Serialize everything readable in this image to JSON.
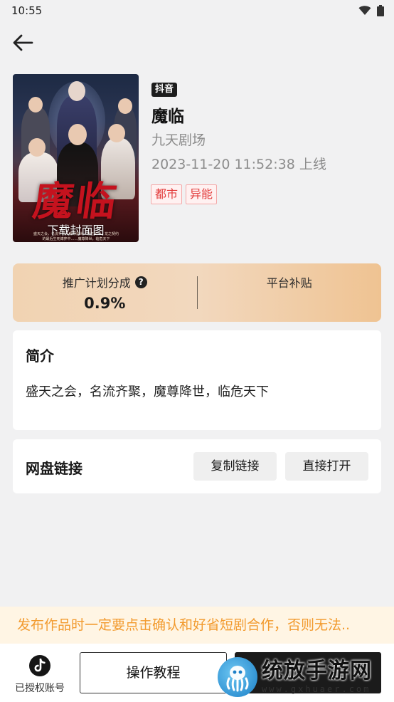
{
  "status_bar": {
    "time": "10:55"
  },
  "drama": {
    "platform": "抖音",
    "title": "魔临",
    "studio": "九天剧场",
    "release": "2023-11-20 11:52:38 上线",
    "tags": [
      "都市",
      "异能"
    ],
    "cover": {
      "calligraphy": "魔临",
      "download_label": "下载封面图",
      "tiny_line_1": "盛天之会，名流齐聚，魔尊降世，临危天下，龙之契约",
      "tiny_line_2": "的最后生死博弈中……魔尊降世，临危天下"
    }
  },
  "commission": {
    "plan_label": "推广计划分成",
    "plan_value": "0.9%",
    "subsidy_label": "平台补贴"
  },
  "intro": {
    "heading": "简介",
    "text": "盛天之会，名流齐聚，魔尊降世，临危天下"
  },
  "pan": {
    "heading": "网盘链接",
    "copy_label": "复制链接",
    "open_label": "直接打开"
  },
  "notice": "发布作品时一定要点击确认和好省短剧合作，否则无法..",
  "bottom": {
    "auth_label": "已授权账号",
    "tutorial_label": "操作教程"
  },
  "watermark": {
    "title": "统放手游网",
    "url": "www.gxhuaer.com"
  },
  "colors": {
    "accent_tag": "#e23a3a",
    "notice": "#f29a2e",
    "commission_gradient_end": "#efc392"
  }
}
